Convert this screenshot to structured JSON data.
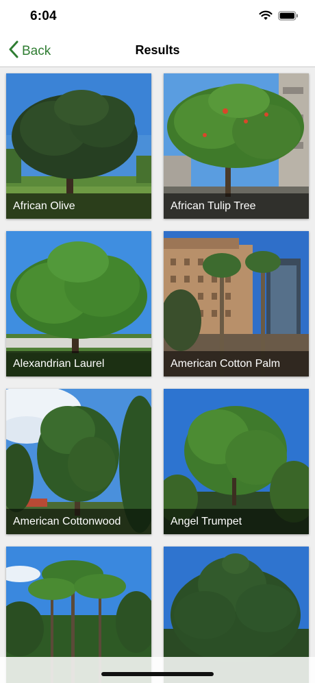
{
  "status_bar": {
    "time": "6:04",
    "icons": [
      "wifi-icon",
      "battery-icon"
    ]
  },
  "nav": {
    "back_label": "Back",
    "back_icon": "chevron-left-icon",
    "title": "Results"
  },
  "colors": {
    "accent": "#2f7d32",
    "background": "#efefef",
    "caption_bg": "rgba(0,0,0,0.55)"
  },
  "results": [
    {
      "name": "African Olive"
    },
    {
      "name": "African Tulip Tree"
    },
    {
      "name": "Alexandrian Laurel"
    },
    {
      "name": "American Cotton Palm"
    },
    {
      "name": "American Cottonwood"
    },
    {
      "name": "Angel Trumpet"
    },
    {
      "name": ""
    },
    {
      "name": ""
    }
  ]
}
